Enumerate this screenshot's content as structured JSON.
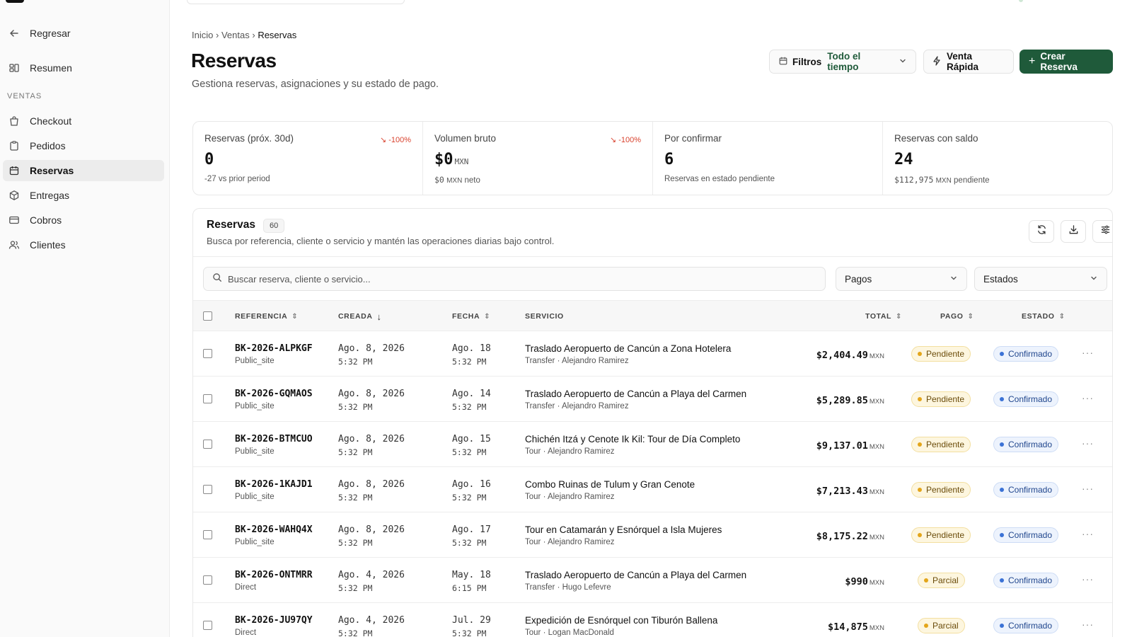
{
  "sidebar": {
    "back": "Regresar",
    "summary": "Resumen",
    "section": "VENTAS",
    "items": [
      {
        "label": "Checkout"
      },
      {
        "label": "Pedidos"
      },
      {
        "label": "Reservas"
      },
      {
        "label": "Entregas"
      },
      {
        "label": "Cobros"
      },
      {
        "label": "Clientes"
      }
    ],
    "active": "Reservas"
  },
  "breadcrumb": {
    "home": "Inicio",
    "section": "Ventas",
    "current": "Reservas",
    "sep": "›"
  },
  "header": {
    "title": "Reservas",
    "subtitle": "Gestiona reservas, asignaciones y su estado de pago.",
    "filters_label": "Filtros",
    "filters_value": "Todo el tiempo",
    "quick_sale": "Venta Rápida",
    "create": "Crear Reserva"
  },
  "stats": [
    {
      "label": "Reservas (próx. 30d)",
      "trend": "↘ -100%",
      "value": "0",
      "currency": "",
      "note": "-27 vs prior period",
      "note_currency": "",
      "note_suffix": ""
    },
    {
      "label": "Volumen bruto",
      "trend": "↘ -100%",
      "value": "$0",
      "currency": "MXN",
      "note": "$0",
      "note_currency": "MXN",
      "note_suffix": "neto"
    },
    {
      "label": "Por confirmar",
      "trend": "",
      "value": "6",
      "currency": "",
      "note": "Reservas en estado pendiente",
      "note_currency": "",
      "note_suffix": ""
    },
    {
      "label": "Reservas con saldo",
      "trend": "",
      "value": "24",
      "currency": "",
      "note": "$112,975",
      "note_currency": "MXN",
      "note_suffix": "pendiente"
    }
  ],
  "table": {
    "title": "Reservas",
    "count": "60",
    "description": "Busca por referencia, cliente o servicio y mantén las operaciones diarias bajo control.",
    "search_placeholder": "Buscar reserva, cliente o servicio...",
    "filter_payments": "Pagos",
    "filter_status": "Estados",
    "columns": {
      "reference": "REFERENCIA",
      "created": "CREADA",
      "date": "FECHA",
      "service": "SERVICIO",
      "total": "TOTAL",
      "payment": "PAGO",
      "status": "ESTADO"
    },
    "rows": [
      {
        "ref": "BK-2026-ALPKGF",
        "source": "Public_site",
        "created": "Ago. 8, 2026",
        "created_time": "5:32 PM",
        "date": "Ago. 18",
        "date_time": "5:32 PM",
        "service": "Traslado Aeropuerto de Cancún a Zona Hotelera",
        "service_meta": "Transfer · Alejandro Ramirez",
        "total": "$2,404.49",
        "currency": "MXN",
        "payment": "Pendiente",
        "status": "Confirmado"
      },
      {
        "ref": "BK-2026-GQMAOS",
        "source": "Public_site",
        "created": "Ago. 8, 2026",
        "created_time": "5:32 PM",
        "date": "Ago. 14",
        "date_time": "5:32 PM",
        "service": "Traslado Aeropuerto de Cancún a Playa del Carmen",
        "service_meta": "Transfer · Alejandro Ramirez",
        "total": "$5,289.85",
        "currency": "MXN",
        "payment": "Pendiente",
        "status": "Confirmado"
      },
      {
        "ref": "BK-2026-BTMCUO",
        "source": "Public_site",
        "created": "Ago. 8, 2026",
        "created_time": "5:32 PM",
        "date": "Ago. 15",
        "date_time": "5:32 PM",
        "service": "Chichén Itzá y Cenote Ik Kil: Tour de Día Completo",
        "service_meta": "Tour · Alejandro Ramirez",
        "total": "$9,137.01",
        "currency": "MXN",
        "payment": "Pendiente",
        "status": "Confirmado"
      },
      {
        "ref": "BK-2026-1KAJD1",
        "source": "Public_site",
        "created": "Ago. 8, 2026",
        "created_time": "5:32 PM",
        "date": "Ago. 16",
        "date_time": "5:32 PM",
        "service": "Combo Ruinas de Tulum y Gran Cenote",
        "service_meta": "Tour · Alejandro Ramirez",
        "total": "$7,213.43",
        "currency": "MXN",
        "payment": "Pendiente",
        "status": "Confirmado"
      },
      {
        "ref": "BK-2026-WAHQ4X",
        "source": "Public_site",
        "created": "Ago. 8, 2026",
        "created_time": "5:32 PM",
        "date": "Ago. 17",
        "date_time": "5:32 PM",
        "service": "Tour en Catamarán y Esnórquel a Isla Mujeres",
        "service_meta": "Tour · Alejandro Ramirez",
        "total": "$8,175.22",
        "currency": "MXN",
        "payment": "Pendiente",
        "status": "Confirmado"
      },
      {
        "ref": "BK-2026-ONTMRR",
        "source": "Direct",
        "created": "Ago. 4, 2026",
        "created_time": "5:32 PM",
        "date": "May. 18",
        "date_time": "6:15 PM",
        "service": "Traslado Aeropuerto de Cancún a Playa del Carmen",
        "service_meta": "Transfer · Hugo Lefevre",
        "total": "$990",
        "currency": "MXN",
        "payment": "Parcial",
        "status": "Confirmado"
      },
      {
        "ref": "BK-2026-JU97QY",
        "source": "Direct",
        "created": "Ago. 4, 2026",
        "created_time": "5:32 PM",
        "date": "Jul. 29",
        "date_time": "5:32 PM",
        "service": "Expedición de Esnórquel con Tiburón Ballena",
        "service_meta": "Tour · Logan MacDonald",
        "total": "$14,875",
        "currency": "MXN",
        "payment": "Parcial",
        "status": "Confirmado"
      }
    ]
  },
  "colors": {
    "brand": "#1f5a3a",
    "pending": "#e3a51a",
    "confirmed": "#3b72d6",
    "trend_down": "#d9432f"
  }
}
